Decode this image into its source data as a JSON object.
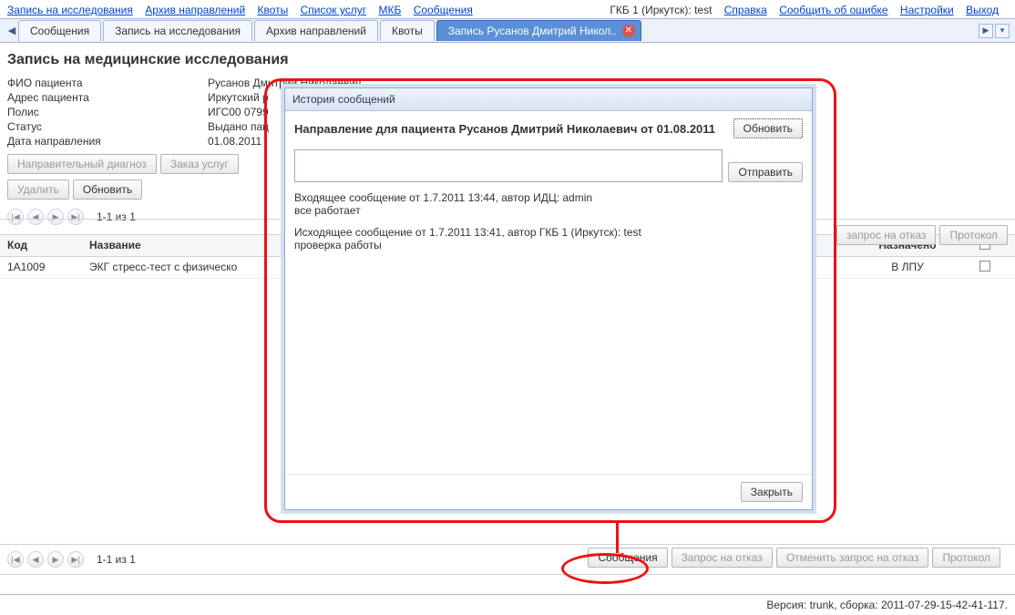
{
  "topbar": {
    "left_links": [
      "Запись на исследования",
      "Архив направлений",
      "Квоты",
      "Список услуг",
      "МКБ",
      "Сообщения"
    ],
    "context": "ГКБ 1 (Иркутск): test",
    "right_links": [
      "Справка",
      "Сообщить об ошибке",
      "Настройки",
      "Выход"
    ]
  },
  "tabs": {
    "items": [
      "Сообщения",
      "Запись на исследования",
      "Архив направлений",
      "Квоты",
      "Запись Русанов Дмитрий Никол.."
    ],
    "active_index": 4
  },
  "page_title": "Запись на медицинские исследования",
  "patient": {
    "rows": [
      {
        "label": "ФИО пациента",
        "value": "Русанов Дмитрий Николаевич"
      },
      {
        "label": "Адрес пациента",
        "value": "Иркутский р"
      },
      {
        "label": "Полис",
        "value": "ИГС00 0799"
      },
      {
        "label": "Статус",
        "value": "Выдано пац"
      },
      {
        "label": "Дата направления",
        "value": "01.08.2011"
      }
    ]
  },
  "buttons_row1": [
    "Направительный диагноз",
    "Заказ услуг"
  ],
  "buttons_row2": [
    "Удалить",
    "Обновить"
  ],
  "pager_text": "1-1  из  1",
  "table": {
    "headers": {
      "code": "Код",
      "name": "Название",
      "assigned": "Назначено",
      "check": ""
    },
    "rows": [
      {
        "code": "1A1009",
        "name": "ЭКГ стресс-тест с физическо",
        "assigned": "В ЛПУ"
      }
    ]
  },
  "actions_mid": [
    "запрос на отказ",
    "Протокол"
  ],
  "actions_bottom": [
    "Сообщения",
    "Запрос на отказ",
    "Отменить запрос на отказ",
    "Протокол"
  ],
  "dialog": {
    "title": "История сообщений",
    "header_text": "Направление для пациента Русанов Дмитрий Николаевич от 01.08.2011",
    "refresh_btn": "Обновить",
    "send_btn": "Отправить",
    "close_btn": "Закрыть",
    "messages": [
      {
        "meta": "Входящее сообщение от 1.7.2011 13:44, автор ИДЦ: admin",
        "text": "все работает"
      },
      {
        "meta": "Исходящее сообщение от 1.7.2011 13:41, автор ГКБ 1 (Иркутск): test",
        "text": "проверка работы"
      }
    ]
  },
  "footer_version": "Версия: trunk, сборка: 2011-07-29-15-42-41-117."
}
